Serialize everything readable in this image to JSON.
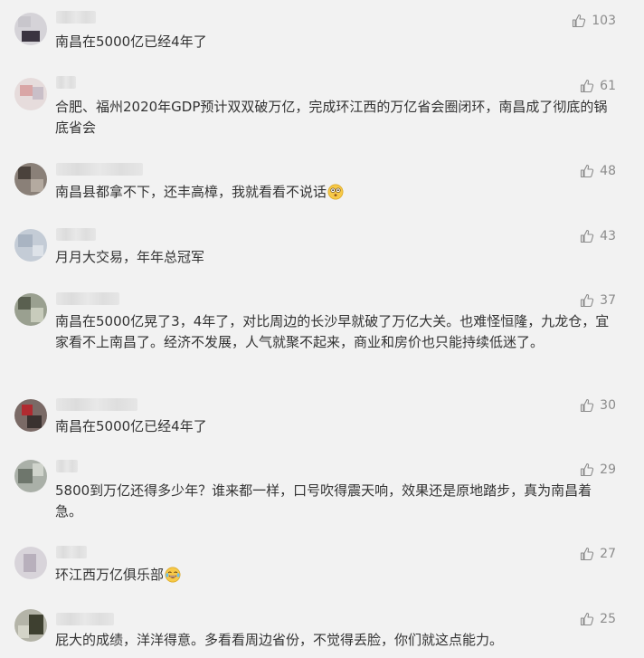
{
  "comments": [
    {
      "text": "南昌在5000亿已经4年了",
      "likes": "103",
      "emoji": ""
    },
    {
      "text": "合肥、福州2020年GDP预计双双破万亿，完成环江西的万亿省会圈闭环，南昌成了彻底的锅底省会",
      "likes": "61",
      "emoji": ""
    },
    {
      "text": "南昌县都拿不下，还丰高樟，我就看看不说话",
      "likes": "48",
      "emoji": "surprised-face"
    },
    {
      "text": "月月大交易，年年总冠军",
      "likes": "43",
      "emoji": ""
    },
    {
      "text": "南昌在5000亿晃了3，4年了，对比周边的长沙早就破了万亿大关。也难怪恒隆，九龙仓，宜家看不上南昌了。经济不发展，人气就聚不起来，商业和房价也只能持续低迷了。",
      "likes": "37",
      "emoji": ""
    },
    {
      "text": "南昌在5000亿已经4年了",
      "likes": "30",
      "emoji": ""
    },
    {
      "text": "5800到万亿还得多少年？谁来都一样，口号吹得震天响，效果还是原地踏步，真为南昌着急。",
      "likes": "29",
      "emoji": ""
    },
    {
      "text": "环江西万亿俱乐部",
      "likes": "27",
      "emoji": "laughing-tears-face"
    },
    {
      "text": "屁大的成绩，洋洋得意。多看看周边省份，不觉得丢脸，你们就这点能力。",
      "likes": "25",
      "emoji": ""
    }
  ],
  "icons": {
    "like": "thumbs-up-icon"
  },
  "colors": {
    "background": "#f2f2f2",
    "text": "#333333",
    "like_count": "#8c8c8c"
  }
}
